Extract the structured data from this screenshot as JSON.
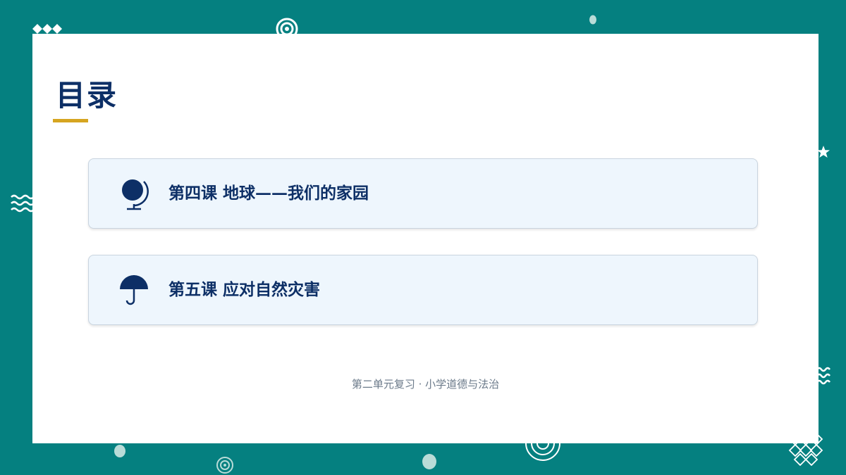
{
  "slide": {
    "title": "目录",
    "items": [
      {
        "label": "第四课 地球——我们的家园",
        "icon": "globe-icon"
      },
      {
        "label": "第五课 应对自然灾害",
        "icon": "umbrella-icon"
      }
    ],
    "footer": "第二单元复习 · 小学道德与法治"
  },
  "colors": {
    "background": "#058080",
    "card": "#ffffff",
    "title": "#0d2f66",
    "accent": "#d6a520",
    "item_bg": "#eef6fd",
    "icon": "#0d2f66"
  }
}
